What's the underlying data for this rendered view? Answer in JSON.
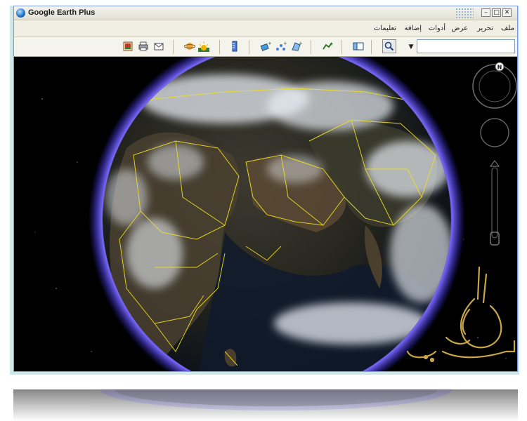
{
  "window": {
    "title": "Google Earth Plus"
  },
  "menu": {
    "items": [
      "ملف",
      "تحرير",
      "عرض",
      "أدوات",
      "إضافة",
      "تعليمات"
    ]
  },
  "search": {
    "value": ""
  },
  "compass": {
    "north_label": "N"
  },
  "colors": {
    "background": "#000000",
    "atmosphere": "#6a5cff",
    "borders": "#f0e020",
    "window_border": "#7a96df"
  },
  "icons": {
    "toolbar": [
      "image-icon",
      "print-icon",
      "email-icon",
      "planet-icon",
      "sun-icon",
      "ruler-icon",
      "add-placemark-icon",
      "add-path-icon",
      "add-polygon-icon",
      "add-tour-icon",
      "sidebar-icon",
      "search-icon"
    ],
    "watermark": "calligraphy-logo"
  }
}
